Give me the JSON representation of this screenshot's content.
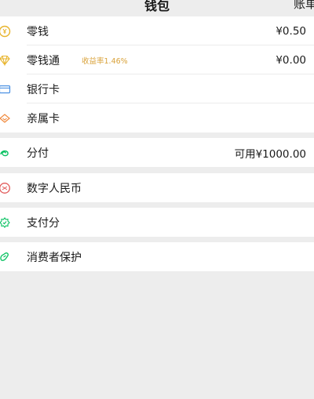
{
  "header": {
    "title": "钱包",
    "bill": "账单"
  },
  "group1": [
    {
      "label": "零钱",
      "value": "¥0.50",
      "icon": "coin-icon"
    },
    {
      "label": "零钱通",
      "tag": "收益率1.46%",
      "value": "¥0.00",
      "icon": "diamond-icon"
    },
    {
      "label": "银行卡",
      "icon": "bank-card-icon"
    },
    {
      "label": "亲属卡",
      "icon": "family-card-icon"
    }
  ],
  "group2": [
    {
      "label": "分付",
      "value": "可用¥1000.00",
      "icon": "fenfu-icon"
    }
  ],
  "group3": [
    {
      "label": "数字人民币",
      "icon": "digital-rmb-icon"
    }
  ],
  "group4": [
    {
      "label": "支付分",
      "icon": "payment-score-icon"
    }
  ],
  "group5": [
    {
      "label": "消费者保护",
      "icon": "consumer-protection-icon"
    }
  ],
  "colors": {
    "accent_gold": "#d9a23a",
    "bank_blue": "#4a90e2",
    "green": "#07c160",
    "red": "#e25a5a"
  }
}
